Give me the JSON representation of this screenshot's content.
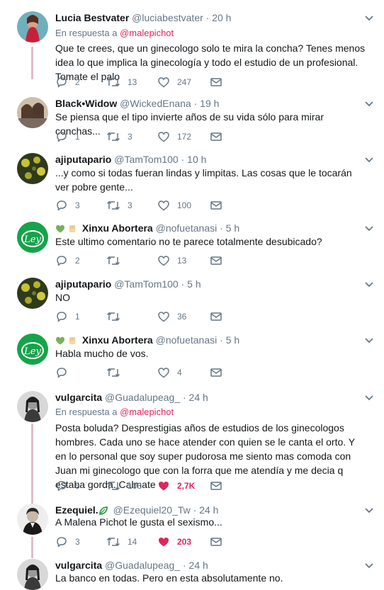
{
  "tweets": [
    {
      "name": "Lucia Bestvater",
      "handle": "@luciabestvater",
      "time": "· 20 h",
      "reply_prefix": "En respuesta a",
      "reply_mention": "@malepichot",
      "text": "Que te crees, que un ginecologo solo te mira la concha? Tenes menos idea lo que implica la ginecología y todo el estudio de un profesional. Tomate el palo",
      "replies": "2",
      "retweets": "13",
      "likes": "247"
    },
    {
      "name": "Black•Widow",
      "handle": "@WickedEnana",
      "time": "· 19 h",
      "text": "Se piensa que el tipo invierte años de su vida sólo para mirar conchas...",
      "replies": "1",
      "retweets": "3",
      "likes": "172"
    },
    {
      "name": "ajiputapario",
      "handle": "@TamTom100",
      "time": "· 10 h",
      "text": "...y como si todas fueran lindas y limpitas. Las cosas que le tocarán ver pobre gente...",
      "replies": "3",
      "retweets": "3",
      "likes": "100"
    },
    {
      "name": "Xinxu Abortera",
      "handle": "@nofuetanasi",
      "time": "· 5 h",
      "text": "Este ultimo comentario no te parece totalmente desubicado?",
      "replies": "2",
      "retweets": "",
      "likes": "13"
    },
    {
      "name": "ajiputapario",
      "handle": "@TamTom100",
      "time": "· 5 h",
      "text": "NO",
      "replies": "1",
      "retweets": "",
      "likes": "36"
    },
    {
      "name": "Xinxu Abortera",
      "handle": "@nofuetanasi",
      "time": "· 5 h",
      "text": "Habla mucho de vos.",
      "replies": "",
      "retweets": "",
      "likes": "4"
    },
    {
      "name": "vulgarcita",
      "handle": "@Guadalupeag_",
      "time": "· 24 h",
      "reply_prefix": "En respuesta a",
      "reply_mention": "@malepichot",
      "text": "Posta boluda? Desprestigias años de estudios de los ginecologos hombres. Cada uno se hace atender con quien se le canta el orto. Y en lo personal que soy super pudorosa me siento mas comoda con Juan mi ginecologo que con la forra que me atendía y me decia q estaba gorda. Calmate",
      "replies": "5",
      "retweets": "103",
      "likes": "2,7K"
    },
    {
      "name": "Ezequiel.",
      "handle": "@Ezequiel20_Tw",
      "time": "· 24 h",
      "text": "A Malena Pichot le gusta el sexismo...",
      "replies": "3",
      "retweets": "14",
      "likes": "203"
    },
    {
      "name": "vulgarcita",
      "handle": "@Guadalupeag_",
      "time": "· 24 h",
      "text": "La banco en todas. Pero en esta absolutamente no.",
      "replies": "",
      "retweets": "",
      "likes": ""
    }
  ],
  "colors": {
    "like_active": "#e0245e",
    "thread_line": "#e1bcc6",
    "muted": "#657786",
    "avatar_green": "#17a34a"
  },
  "icons": [
    "reply-icon",
    "retweet-icon",
    "like-icon",
    "message-icon",
    "chevron-down-icon",
    "green-heart-emoji",
    "raised-fist-emoji",
    "verified-leaf-icon"
  ]
}
